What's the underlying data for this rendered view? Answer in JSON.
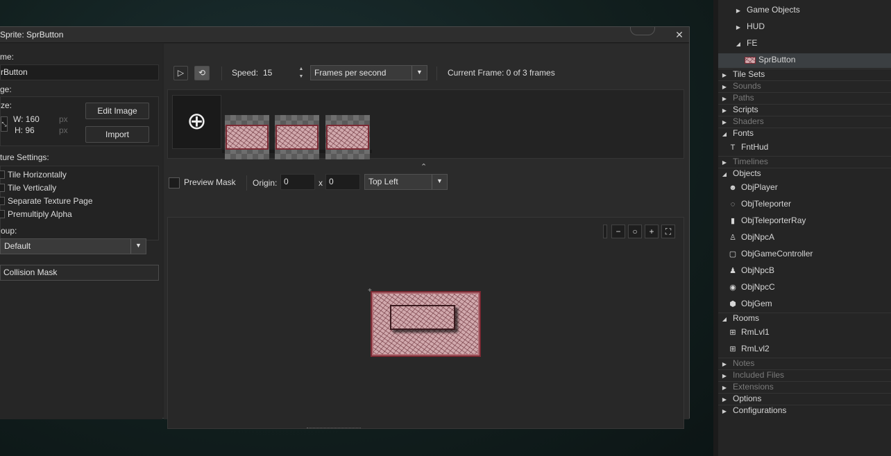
{
  "window": {
    "title": "Sprite: SprButton",
    "close_icon": "close-icon"
  },
  "left_panel": {
    "name_label": "me:",
    "name_value": "rButton",
    "image_label": "ge:",
    "size_label": "ze:",
    "width": "W: 160",
    "height": "H: 96",
    "px1": "px",
    "px2": "px",
    "edit_image": "Edit Image",
    "import": "Import",
    "texture_settings_label": "ture Settings:",
    "checks": [
      "Tile Horizontally",
      "Tile Vertically",
      "Separate Texture Page",
      "Premultiply Alpha"
    ],
    "group_label": "oup:",
    "group_value": "Default",
    "collision_mask": "Collision Mask"
  },
  "toolbar": {
    "speed_label": "Speed:",
    "speed_value": "15",
    "speed_unit": "Frames per second",
    "current_frame": "Current Frame: 0 of 3 frames"
  },
  "frames": {
    "count": 3
  },
  "mask_bar": {
    "preview_mask": "Preview Mask",
    "origin_label": "Origin:",
    "origin_x": "0",
    "origin_sep": "x",
    "origin_y": "0",
    "origin_preset": "Top Left"
  },
  "resources": {
    "tree": [
      {
        "label": "Game Objects",
        "level": 2,
        "arrow": "▶"
      },
      {
        "label": "HUD",
        "level": 2,
        "arrow": "▶"
      },
      {
        "label": "FE",
        "level": 2,
        "arrow": "◢"
      },
      {
        "label": "SprButton",
        "level": 3,
        "arrow": "",
        "selected": true
      },
      {
        "label": "Tile Sets",
        "level": 0,
        "arrow": "▶"
      },
      {
        "label": "Sounds",
        "level": 0,
        "arrow": "▶",
        "dim": true
      },
      {
        "label": "Paths",
        "level": 0,
        "arrow": "▶",
        "dim": true
      },
      {
        "label": "Scripts",
        "level": 0,
        "arrow": "▶"
      },
      {
        "label": "Shaders",
        "level": 0,
        "arrow": "▶",
        "dim": true
      },
      {
        "label": "Fonts",
        "level": 0,
        "arrow": "◢"
      },
      {
        "label": "FntHud",
        "level": 1,
        "arrow": "",
        "icon": "T"
      },
      {
        "label": "Timelines",
        "level": 0,
        "arrow": "▶",
        "dim": true
      },
      {
        "label": "Objects",
        "level": 0,
        "arrow": "◢"
      },
      {
        "label": "ObjPlayer",
        "level": 1,
        "arrow": "",
        "icon": "☻"
      },
      {
        "label": "ObjTeleporter",
        "level": 1,
        "arrow": "",
        "icon": "◌"
      },
      {
        "label": "ObjTeleporterRay",
        "level": 1,
        "arrow": "",
        "icon": "▮"
      },
      {
        "label": "ObjNpcA",
        "level": 1,
        "arrow": "",
        "icon": "♙"
      },
      {
        "label": "ObjGameController",
        "level": 1,
        "arrow": "",
        "icon": "▢"
      },
      {
        "label": "ObjNpcB",
        "level": 1,
        "arrow": "",
        "icon": "♟"
      },
      {
        "label": "ObjNpcC",
        "level": 1,
        "arrow": "",
        "icon": "◉"
      },
      {
        "label": "ObjGem",
        "level": 1,
        "arrow": "",
        "icon": "⬢"
      },
      {
        "label": "Rooms",
        "level": 0,
        "arrow": "◢"
      },
      {
        "label": "RmLvl1",
        "level": 1,
        "arrow": "",
        "icon": "⊞"
      },
      {
        "label": "RmLvl2",
        "level": 1,
        "arrow": "",
        "icon": "⊞"
      },
      {
        "label": "Notes",
        "level": 0,
        "arrow": "▶",
        "dim": true
      },
      {
        "label": "Included Files",
        "level": 0,
        "arrow": "▶",
        "dim": true
      },
      {
        "label": "Extensions",
        "level": 0,
        "arrow": "▶",
        "dim": true
      },
      {
        "label": "Options",
        "level": 0,
        "arrow": "▶"
      },
      {
        "label": "Configurations",
        "level": 0,
        "arrow": "▶"
      }
    ]
  },
  "colors": {
    "accent_select": "#3a6b5a",
    "sprite_border": "#7c2a34",
    "sprite_fill": "#d1a9ad"
  }
}
